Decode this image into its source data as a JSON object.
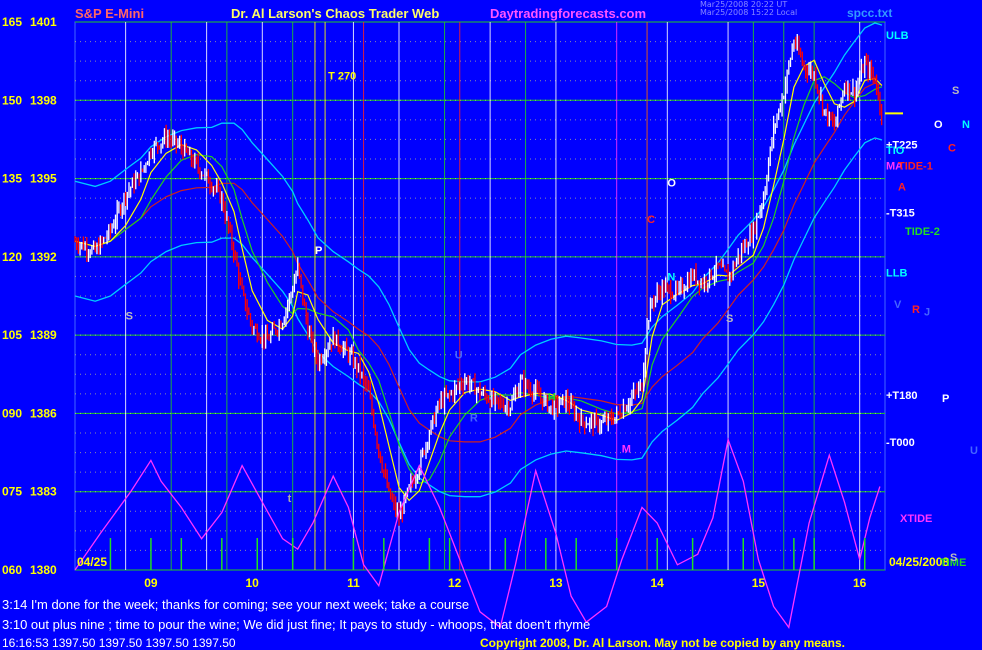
{
  "header": {
    "title": "S&P E-Mini",
    "subtitle": "Dr. Al Larson's Chaos Trader Web",
    "website": "Daytradingforecasts.com",
    "file": "spcc.txt"
  },
  "stamp": [
    "Mar25/2008 20:22 UT",
    "Mar25/2008 15:22 Local"
  ],
  "colors": {
    "background": "#0000ff",
    "grid_green": "#22cc22",
    "grid_white": "#ffffff",
    "up_bar": "#ffffff",
    "down_bar": "#ff0000",
    "xtide": "#ff33ff",
    "spikes": "#22dd22"
  },
  "chart_data": {
    "type": "ohlc",
    "title": "S&P E-Mini",
    "x_ticks": [
      "09",
      "10",
      "11",
      "12",
      "13",
      "14",
      "15",
      "16"
    ],
    "y_ticks": [
      {
        "osc": "165",
        "price": "1401"
      },
      {
        "osc": "150",
        "price": "1398"
      },
      {
        "osc": "135",
        "price": "1395"
      },
      {
        "osc": "120",
        "price": "1392"
      },
      {
        "osc": "105",
        "price": "1389"
      },
      {
        "osc": "090",
        "price": "1386"
      },
      {
        "osc": "075",
        "price": "1383"
      },
      {
        "osc": "060",
        "price": "1380"
      }
    ],
    "ylim": [
      1380,
      1401
    ],
    "x_range_hours": [
      8.25,
      16.25
    ],
    "date_left": "04/25",
    "date_right": "04/25/2008",
    "close_path": [
      [
        8.25,
        1392.6
      ],
      [
        8.45,
        1392.2
      ],
      [
        8.6,
        1393.0
      ],
      [
        8.75,
        1394.4
      ],
      [
        8.9,
        1395.2
      ],
      [
        9.0,
        1396.1
      ],
      [
        9.15,
        1396.6
      ],
      [
        9.3,
        1396.2
      ],
      [
        9.45,
        1395.5
      ],
      [
        9.6,
        1394.8
      ],
      [
        9.7,
        1394.2
      ],
      [
        9.82,
        1392.2
      ],
      [
        9.9,
        1390.6
      ],
      [
        10.0,
        1389.3
      ],
      [
        10.15,
        1388.8
      ],
      [
        10.3,
        1389.6
      ],
      [
        10.4,
        1390.8
      ],
      [
        10.45,
        1391.6
      ],
      [
        10.55,
        1389.2
      ],
      [
        10.65,
        1388.0
      ],
      [
        10.8,
        1388.9
      ],
      [
        10.95,
        1388.3
      ],
      [
        11.05,
        1387.7
      ],
      [
        11.15,
        1386.8
      ],
      [
        11.25,
        1384.6
      ],
      [
        11.35,
        1382.9
      ],
      [
        11.45,
        1382.0
      ],
      [
        11.55,
        1383.1
      ],
      [
        11.65,
        1384.0
      ],
      [
        11.75,
        1385.3
      ],
      [
        11.85,
        1386.4
      ],
      [
        11.95,
        1386.7
      ],
      [
        12.1,
        1387.3
      ],
      [
        12.25,
        1386.8
      ],
      [
        12.4,
        1386.4
      ],
      [
        12.55,
        1386.3
      ],
      [
        12.65,
        1387.2
      ],
      [
        12.8,
        1386.8
      ],
      [
        12.95,
        1386.2
      ],
      [
        13.1,
        1386.5
      ],
      [
        13.25,
        1385.7
      ],
      [
        13.45,
        1385.6
      ],
      [
        13.6,
        1385.9
      ],
      [
        13.75,
        1386.6
      ],
      [
        13.85,
        1387.1
      ],
      [
        13.9,
        1389.4
      ],
      [
        13.95,
        1390.3
      ],
      [
        14.05,
        1390.8
      ],
      [
        14.2,
        1390.6
      ],
      [
        14.35,
        1391.3
      ],
      [
        14.45,
        1391.0
      ],
      [
        14.6,
        1391.6
      ],
      [
        14.7,
        1391.2
      ],
      [
        14.8,
        1392.0
      ],
      [
        14.95,
        1393.0
      ],
      [
        15.05,
        1394.3
      ],
      [
        15.15,
        1396.9
      ],
      [
        15.25,
        1398.3
      ],
      [
        15.35,
        1400.3
      ],
      [
        15.45,
        1399.3
      ],
      [
        15.55,
        1399.0
      ],
      [
        15.65,
        1397.6
      ],
      [
        15.75,
        1397.0
      ],
      [
        15.85,
        1398.6
      ],
      [
        15.95,
        1398.3
      ],
      [
        16.05,
        1399.4
      ],
      [
        16.15,
        1398.8
      ],
      [
        16.22,
        1397.5
      ]
    ],
    "time_lines": [
      {
        "t": 8.75,
        "color": "#ffffff"
      },
      {
        "t": 9.2,
        "color": "#22cc22"
      },
      {
        "t": 9.55,
        "color": "#ffffff"
      },
      {
        "t": 9.75,
        "color": "#22cc22"
      },
      {
        "t": 10.1,
        "color": "#ffffff"
      },
      {
        "t": 10.4,
        "color": "#22cc22"
      },
      {
        "t": 10.62,
        "color": "#ffff00"
      },
      {
        "t": 10.72,
        "color": "#ffff00"
      },
      {
        "t": 11.0,
        "color": "#ffffff"
      },
      {
        "t": 11.1,
        "color": "#ff2222"
      },
      {
        "t": 11.45,
        "color": "#ffffff"
      },
      {
        "t": 11.9,
        "color": "#22cc22"
      },
      {
        "t": 12.05,
        "color": "#ff2222"
      },
      {
        "t": 12.35,
        "color": "#ffffff"
      },
      {
        "t": 12.7,
        "color": "#22cc22"
      },
      {
        "t": 13.0,
        "color": "#ffffff"
      },
      {
        "t": 13.6,
        "color": "#ff33ff"
      },
      {
        "t": 13.9,
        "color": "#ff6600"
      },
      {
        "t": 14.1,
        "color": "#ffffff"
      },
      {
        "t": 14.7,
        "color": "#ffffff"
      },
      {
        "t": 14.95,
        "color": "#22cc22"
      },
      {
        "t": 15.25,
        "color": "#22cc22"
      },
      {
        "t": 15.55,
        "color": "#22cc22"
      },
      {
        "t": 16.0,
        "color": "#ffffff"
      }
    ],
    "xtide_wave": [
      [
        8.25,
        60
      ],
      [
        8.5,
        67
      ],
      [
        8.8,
        75
      ],
      [
        9.0,
        81
      ],
      [
        9.1,
        77
      ],
      [
        9.3,
        72
      ],
      [
        9.5,
        66
      ],
      [
        9.7,
        71
      ],
      [
        9.9,
        80
      ],
      [
        10.1,
        73
      ],
      [
        10.3,
        66
      ],
      [
        10.45,
        64
      ],
      [
        10.6,
        69
      ],
      [
        10.8,
        78
      ],
      [
        10.95,
        72
      ],
      [
        11.1,
        61
      ],
      [
        11.25,
        57
      ],
      [
        11.45,
        71
      ],
      [
        11.65,
        80
      ],
      [
        11.85,
        72
      ],
      [
        12.05,
        62
      ],
      [
        12.25,
        52
      ],
      [
        12.45,
        49
      ],
      [
        12.6,
        61
      ],
      [
        12.8,
        79
      ],
      [
        13.0,
        67
      ],
      [
        13.15,
        55
      ],
      [
        13.3,
        50
      ],
      [
        13.5,
        53
      ],
      [
        13.65,
        62
      ],
      [
        13.85,
        72
      ],
      [
        14.0,
        69
      ],
      [
        14.2,
        61
      ],
      [
        14.4,
        63
      ],
      [
        14.55,
        70
      ],
      [
        14.7,
        85
      ],
      [
        14.85,
        77
      ],
      [
        15.0,
        62
      ],
      [
        15.15,
        53
      ],
      [
        15.3,
        49
      ],
      [
        15.5,
        69
      ],
      [
        15.7,
        82
      ],
      [
        15.85,
        73
      ],
      [
        16.0,
        62
      ],
      [
        16.1,
        70
      ],
      [
        16.2,
        76
      ]
    ],
    "spikes": [
      8.6,
      9.0,
      9.3,
      9.7,
      10.05,
      10.4,
      11.0,
      11.3,
      11.75,
      11.95,
      12.5,
      12.9,
      13.2,
      13.6,
      14.0,
      14.35,
      14.85,
      15.35,
      15.55,
      16.05
    ],
    "label_axis": [
      {
        "text": "ULB",
        "value": 1400.5,
        "color": "#00ffff"
      },
      {
        "text": "+T225",
        "value": 1396.3,
        "color": "#ffffff"
      },
      {
        "text": "TIO",
        "value": 1396.1,
        "color": "#00ffff"
      },
      {
        "text": "MA",
        "value": 1395.5,
        "color": "#ff33ff"
      },
      {
        "text": "TIDE-1",
        "value": 1395.5,
        "color": "#ff2222"
      },
      {
        "text": "A",
        "value": 1394.7,
        "color": "#ff2222"
      },
      {
        "text": "-T315",
        "value": 1393.7,
        "color": "#ffffff"
      },
      {
        "text": "TIDE-2",
        "value": 1393.0,
        "color": "#22dd22"
      },
      {
        "text": "LLB",
        "value": 1391.4,
        "color": "#00ffff"
      },
      {
        "text": "+T180",
        "value": 1386.7,
        "color": "#ffffff"
      },
      {
        "text": "-T000",
        "value": 1384.9,
        "color": "#ffffff"
      },
      {
        "text": "XTIDE",
        "value": 1382.0,
        "color": "#ff33ff"
      },
      {
        "text": "TIME",
        "value": 1380.3,
        "color": "#22dd22"
      }
    ],
    "side_letters": [
      {
        "text": "S",
        "value": 1398.4,
        "color": "#bbbbbb"
      },
      {
        "text": "O",
        "value": 1397.1,
        "color": "#ffffff"
      },
      {
        "text": "N",
        "value": 1397.1,
        "color": "#00ffff"
      },
      {
        "text": "C",
        "value": 1396.2,
        "color": "#ff2222"
      },
      {
        "text": "V",
        "value": 1390.2,
        "color": "#4466ff"
      },
      {
        "text": "R",
        "value": 1390.0,
        "color": "#ff2222"
      },
      {
        "text": "J",
        "value": 1389.9,
        "color": "#4466ff"
      },
      {
        "text": "P",
        "value": 1386.6,
        "color": "#ffffff"
      },
      {
        "text": "U",
        "value": 1384.6,
        "color": "#4466ff"
      },
      {
        "text": "S",
        "value": 1380.5,
        "color": "#bbbbbb"
      }
    ],
    "inline_labels": [
      {
        "text": "T 270",
        "t": 10.75,
        "value": 1398.8,
        "color": "#ffff00"
      },
      {
        "text": "P",
        "t": 10.62,
        "value": 1392.1,
        "color": "#ffffff"
      },
      {
        "text": "S",
        "t": 8.75,
        "value": 1389.6,
        "color": "#bbbbbb"
      },
      {
        "text": "C",
        "t": 13.9,
        "value": 1393.3,
        "color": "#ff2222"
      },
      {
        "text": "O",
        "t": 14.1,
        "value": 1394.7,
        "color": "#ffffff"
      },
      {
        "text": "N",
        "t": 14.1,
        "value": 1391.1,
        "color": "#00ffff"
      },
      {
        "text": "S",
        "t": 14.68,
        "value": 1389.5,
        "color": "#bbbbbb"
      },
      {
        "text": "H",
        "t": 12.92,
        "value": 1386.5,
        "color": "#22dd22"
      },
      {
        "text": "M",
        "t": 13.65,
        "value": 1384.5,
        "color": "#ff33ff"
      },
      {
        "text": "U",
        "t": 12.0,
        "value": 1388.1,
        "color": "#4466ff"
      },
      {
        "text": "R",
        "t": 12.15,
        "value": 1385.7,
        "color": "#4466ff"
      },
      {
        "text": "t",
        "t": 10.35,
        "value": 1382.6,
        "color": "#aaaaaa"
      }
    ],
    "quote": "16:16:53  1397.50  1397.50  1397.50  1397.50"
  },
  "messages": [
    "3:14 I'm done for the week; thanks for coming; see your next week; take a course",
    "3:10 out plus nine ; time to pour the wine; We did just fine; It pays to study - whoops, that doen't rhyme"
  ],
  "copyright": "Copyright 2008, Dr. Al Larson. May not be copied by any means."
}
